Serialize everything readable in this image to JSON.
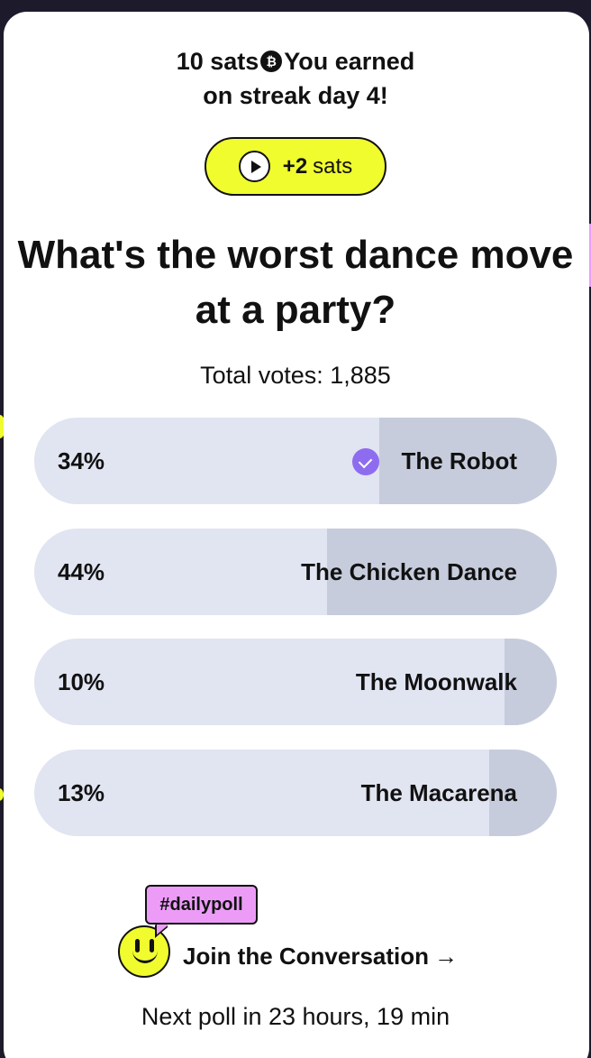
{
  "streak": {
    "line1_amount": "10 sats",
    "line1_suffix": "You earned",
    "line2": "on streak day 4!",
    "coin_icon": "bitcoin-coin-icon"
  },
  "bonus": {
    "amount": "+2",
    "unit": "sats",
    "icon": "play-icon"
  },
  "question": "What's the worst dance move at a party?",
  "total_votes": "Total votes: 1,885",
  "options": [
    {
      "pct_text": "34%",
      "label": "The Robot",
      "fill_fraction": 0.34,
      "selected": true
    },
    {
      "pct_text": "44%",
      "label": "The Chicken Dance",
      "fill_fraction": 0.44,
      "selected": false
    },
    {
      "pct_text": "10%",
      "label": "The Moonwalk",
      "fill_fraction": 0.1,
      "selected": false
    },
    {
      "pct_text": "13%",
      "label": "The Macarena",
      "fill_fraction": 0.13,
      "selected": false
    }
  ],
  "community": {
    "hashtag": "#dailypoll",
    "join_label": "Join the Conversation",
    "arrow": "→"
  },
  "next_poll": "Next poll in 23 hours, 19 min",
  "colors": {
    "accent_yellow": "#f0fc2e",
    "bar_bg": "#e1e4f1",
    "bar_fill": "#c6ccdc",
    "check_purple": "#8e6cf0",
    "bubble_pink": "#ec9cf7"
  }
}
